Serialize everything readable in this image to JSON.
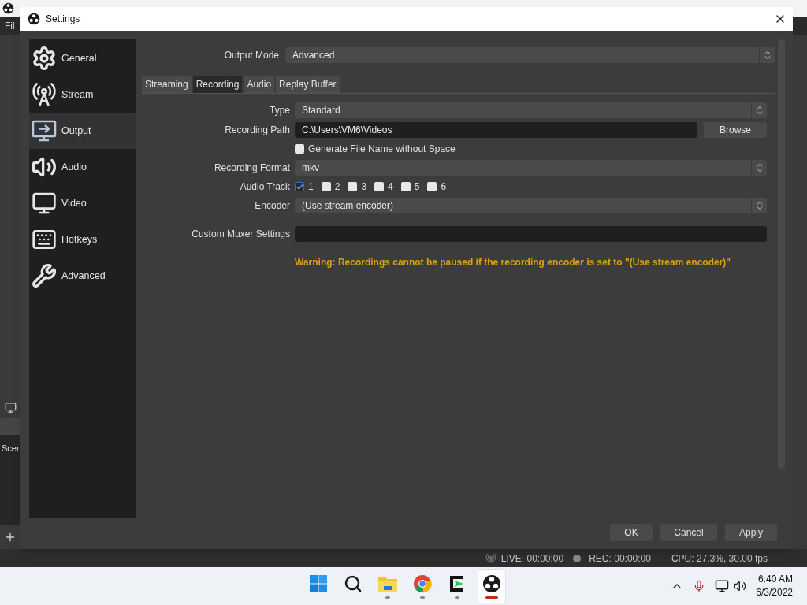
{
  "background_window": {
    "menu_label": "Fil",
    "dock_label": "Scer"
  },
  "dialog": {
    "title": "Settings"
  },
  "sidebar": [
    {
      "label": "General",
      "kind": "gear",
      "selected": false
    },
    {
      "label": "Stream",
      "kind": "antenna",
      "selected": false
    },
    {
      "label": "Output",
      "kind": "output",
      "selected": true
    },
    {
      "label": "Audio",
      "kind": "speaker",
      "selected": false
    },
    {
      "label": "Video",
      "kind": "monitor",
      "selected": false
    },
    {
      "label": "Hotkeys",
      "kind": "keyboard",
      "selected": false
    },
    {
      "label": "Advanced",
      "kind": "tools",
      "selected": false
    }
  ],
  "output_mode": {
    "label": "Output Mode",
    "value": "Advanced"
  },
  "tabs": [
    {
      "label": "Streaming",
      "selected": false
    },
    {
      "label": "Recording",
      "selected": true
    },
    {
      "label": "Audio",
      "selected": false
    },
    {
      "label": "Replay Buffer",
      "selected": false
    }
  ],
  "form": {
    "type": {
      "label": "Type",
      "value": "Standard"
    },
    "recording_path": {
      "label": "Recording Path",
      "value": "C:\\Users\\VM6\\Videos",
      "button": "Browse"
    },
    "generate_name": {
      "label": "Generate File Name without Space",
      "checked": false
    },
    "recording_format": {
      "label": "Recording Format",
      "value": "mkv"
    },
    "audio_track": {
      "label": "Audio Track",
      "tracks": [
        {
          "label": "1",
          "checked": true
        },
        {
          "label": "2",
          "checked": false
        },
        {
          "label": "3",
          "checked": false
        },
        {
          "label": "4",
          "checked": false
        },
        {
          "label": "5",
          "checked": false
        },
        {
          "label": "6",
          "checked": false
        }
      ]
    },
    "encoder": {
      "label": "Encoder",
      "value": "(Use stream encoder)"
    },
    "custom_muxer": {
      "label": "Custom Muxer Settings"
    }
  },
  "warning": "Warning: Recordings cannot be paused if the recording encoder is set to \"(Use stream encoder)\"",
  "buttons": [
    "OK",
    "Cancel",
    "Apply"
  ],
  "status_bar": {
    "live": "LIVE: 00:00:00",
    "rec": "REC: 00:00:00",
    "cpu": "CPU: 27.3%, 30.00 fps"
  },
  "taskbar": {
    "apps": [
      {
        "kind": "start",
        "running": false,
        "selected": false
      },
      {
        "kind": "search",
        "running": false,
        "selected": false
      },
      {
        "kind": "folder",
        "running": true,
        "selected": false
      },
      {
        "kind": "browser",
        "running": true,
        "selected": false
      },
      {
        "kind": "terminal",
        "running": true,
        "selected": false
      },
      {
        "kind": "obs",
        "running": true,
        "selected": true
      }
    ],
    "time": "6:40 AM",
    "date": "6/3/2022"
  }
}
